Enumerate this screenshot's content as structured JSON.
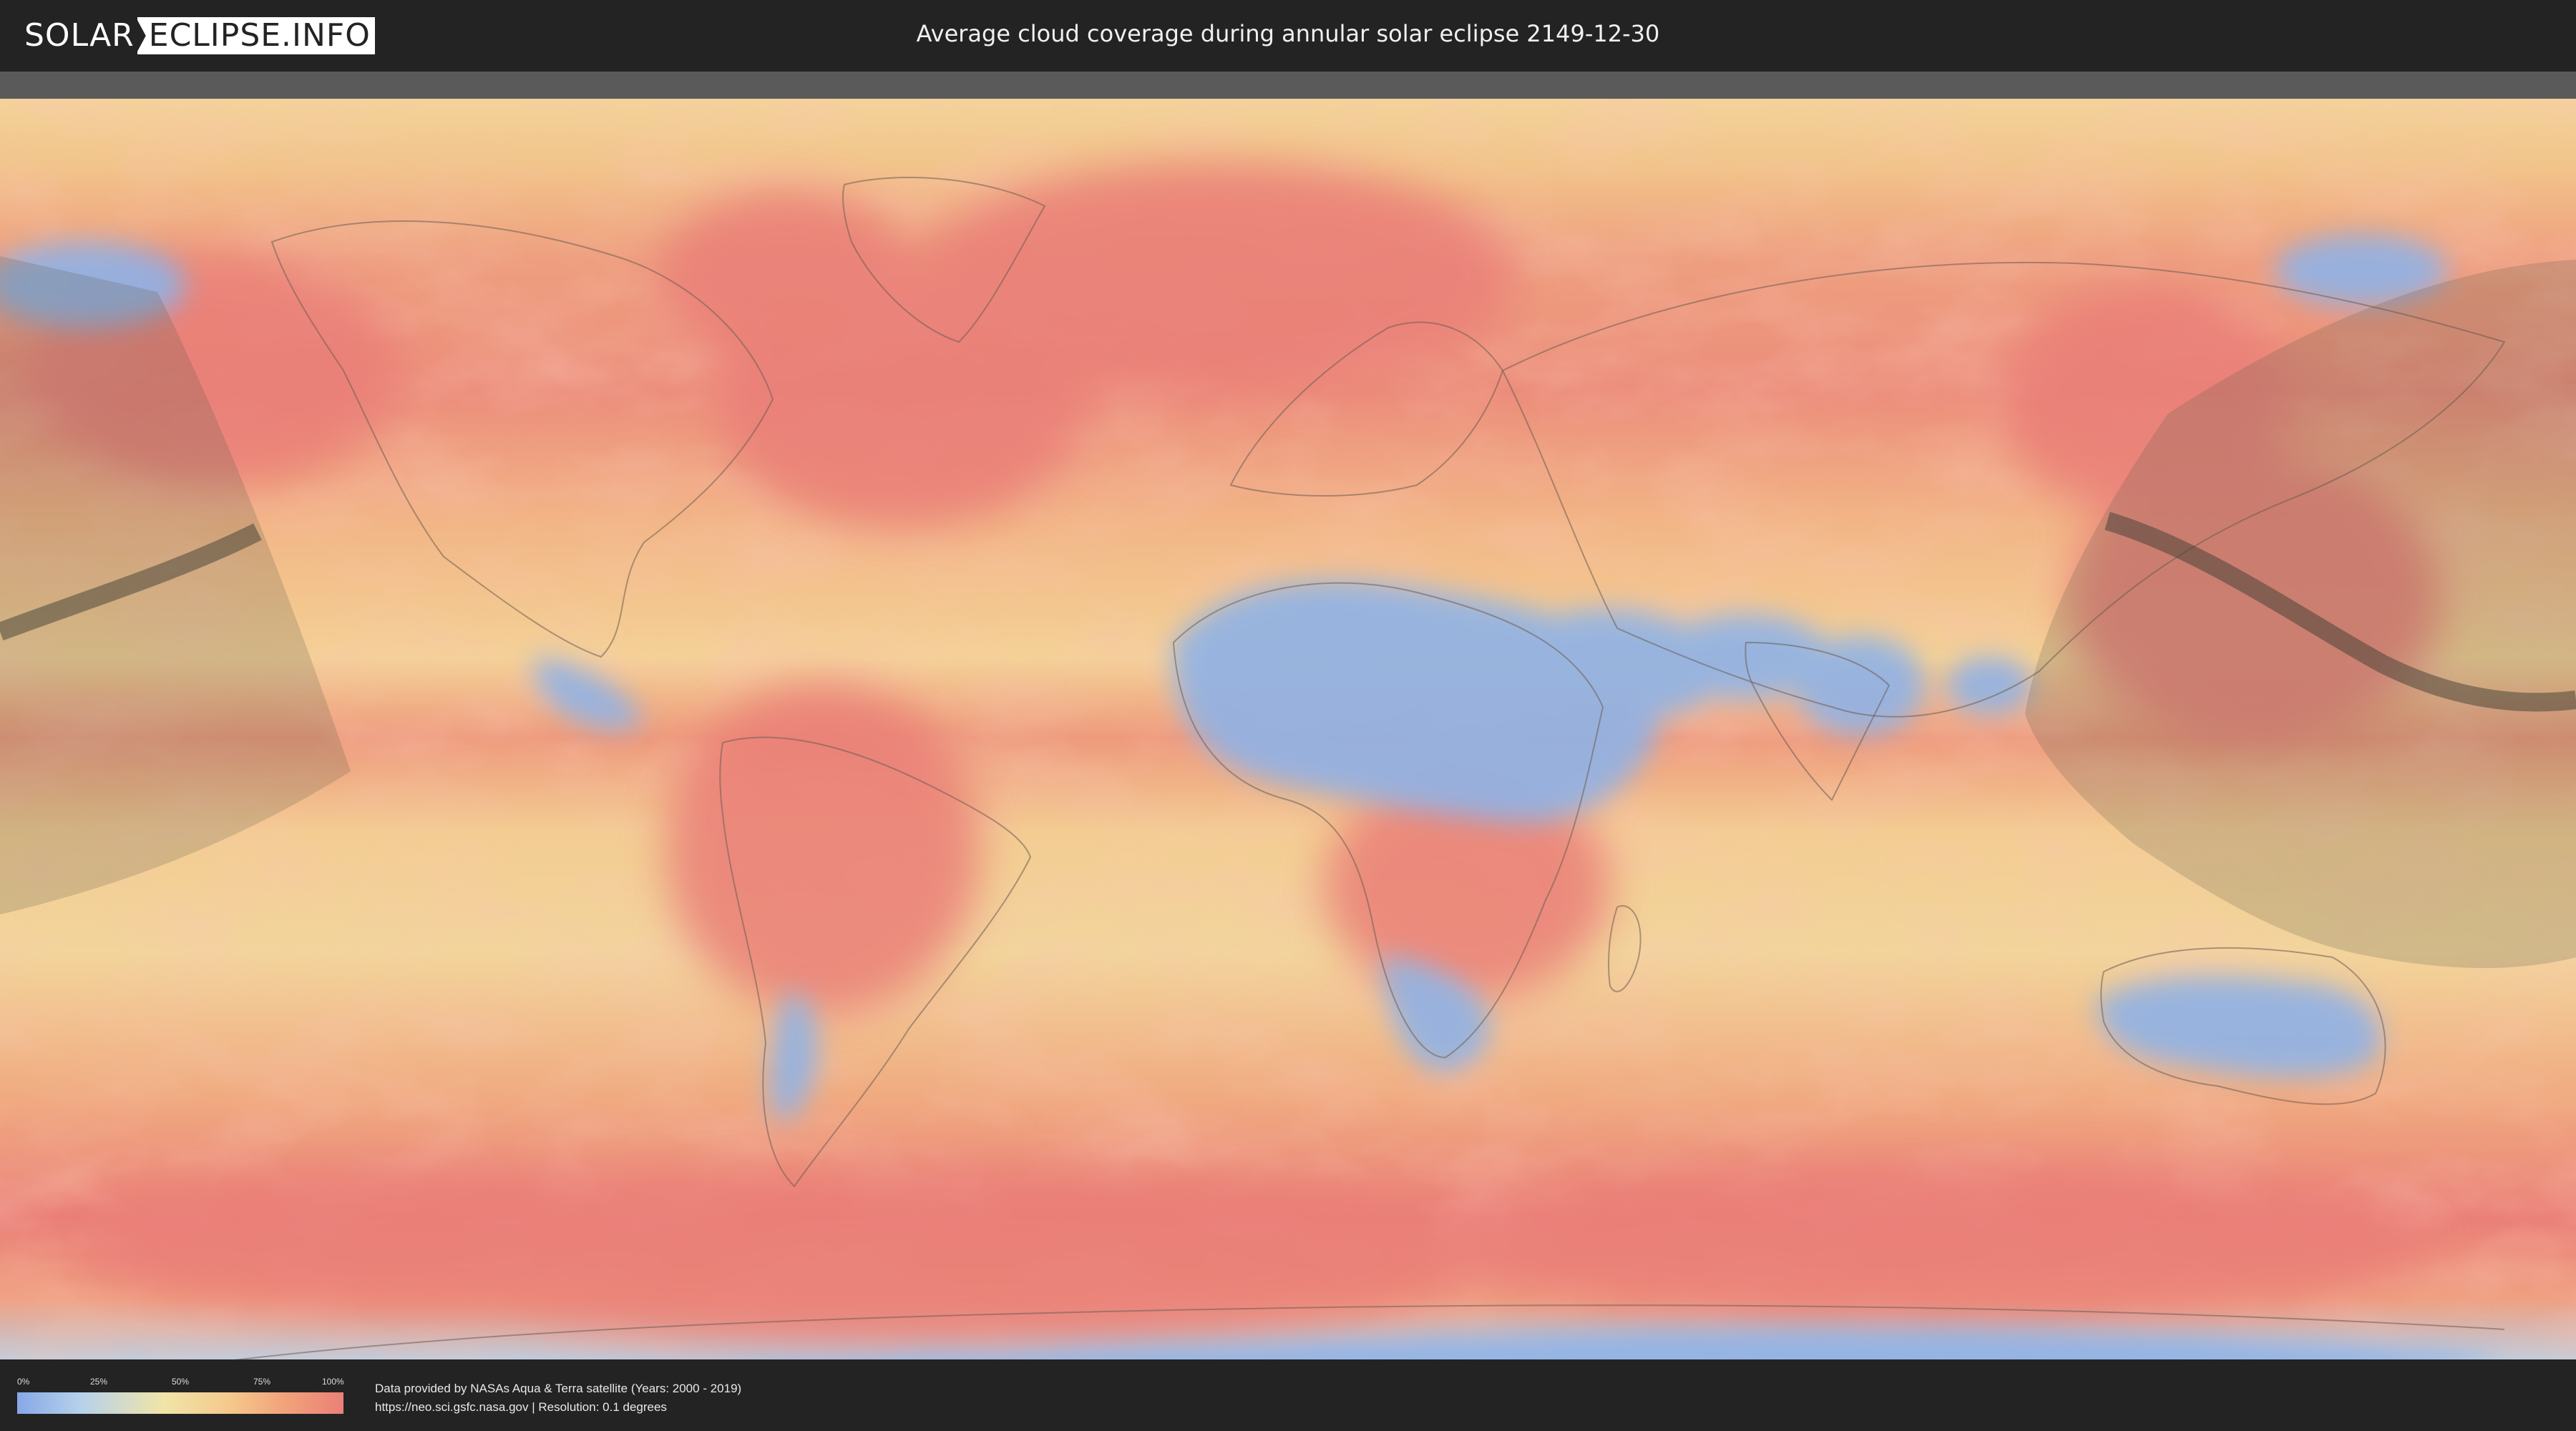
{
  "header": {
    "logo_left": "SOLAR",
    "logo_right": "ECLIPSE.INFO",
    "title": "Average cloud coverage during annular solar eclipse 2149-12-30"
  },
  "legend": {
    "ticks": [
      "0%",
      "25%",
      "50%",
      "75%",
      "100%"
    ],
    "colors": [
      "#86a8e7",
      "#b7d2ea",
      "#f1e4a8",
      "#f4c98c",
      "#ea8078"
    ]
  },
  "attribution": {
    "line1": "Data provided by NASAs Aqua & Terra satellite (Years: 2000 - 2019)",
    "line2": "https://neo.sci.gsfc.nasa.gov | Resolution: 0.1 degrees"
  },
  "map": {
    "colors": {
      "high_cloud": "#ea7f78",
      "mid_cloud": "#f2c48a",
      "low_cloud": "#8fb2e6",
      "eclipse_shadow": "#5c5a4a",
      "central_path": "#3f3d33"
    }
  }
}
